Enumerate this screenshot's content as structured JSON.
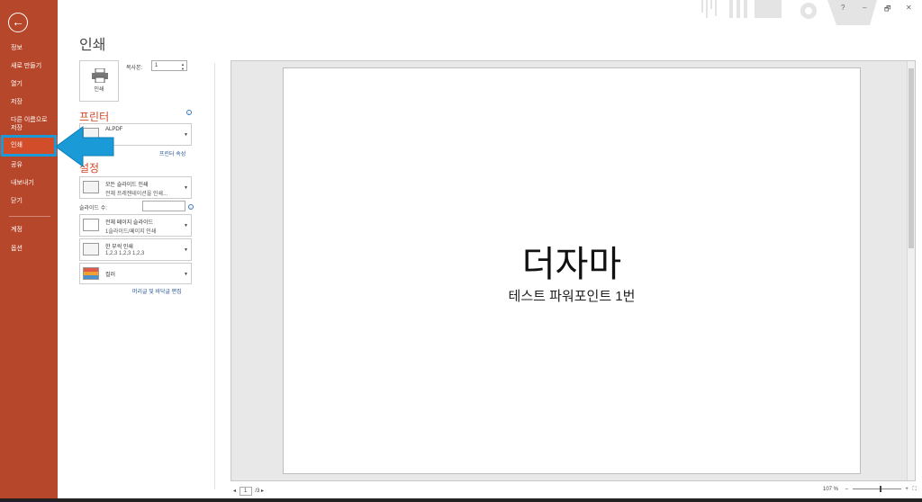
{
  "sidebar": {
    "items": [
      {
        "label": "정보"
      },
      {
        "label": "새로 만들기"
      },
      {
        "label": "열기"
      },
      {
        "label": "저장"
      },
      {
        "label": "다른 이름으로"
      },
      {
        "label": "저장"
      },
      {
        "label": "인쇄"
      },
      {
        "label": "공유"
      },
      {
        "label": "내보내기"
      },
      {
        "label": "닫기"
      },
      {
        "label": "계정"
      },
      {
        "label": "옵션"
      }
    ],
    "active_item": "인쇄",
    "accent": "#b7472a",
    "highlight_color": "#1a9ad6"
  },
  "window": {
    "help": "?",
    "minimize": "–",
    "restore": "🗗",
    "close": "✕"
  },
  "page": {
    "title": "인쇄"
  },
  "print": {
    "button_label": "인쇄",
    "copies_label": "복사본:",
    "copies_value": "1"
  },
  "printer": {
    "heading": "프린터",
    "name": "ALPDF",
    "properties_link": "프린터 속성"
  },
  "settings": {
    "heading": "설정",
    "range": {
      "line1": "모든 슬라이드 인쇄",
      "line2": "전체 프레젠테이션을 인쇄..."
    },
    "slides_label": "슬라이드 수:",
    "slides_value": "",
    "layout": {
      "line1": "전체 페이지 슬라이드",
      "line2": "1슬라이드/페이지 인쇄"
    },
    "collate": {
      "line1": "한 부씩 인쇄",
      "line2": "1,2,3    1,2,3    1,2,3"
    },
    "color": {
      "line1": "컬러"
    },
    "header_footer_link": "머리글 및 바닥글 편집"
  },
  "preview": {
    "slide_title": "더자마",
    "slide_subtitle": "테스트 파워포인트 1번"
  },
  "pager": {
    "prev": "◂",
    "current": "1",
    "total": "/3",
    "next": "▸"
  },
  "zoom": {
    "value": "107 %",
    "minus": "–",
    "plus": "+",
    "fit": "⛶"
  }
}
